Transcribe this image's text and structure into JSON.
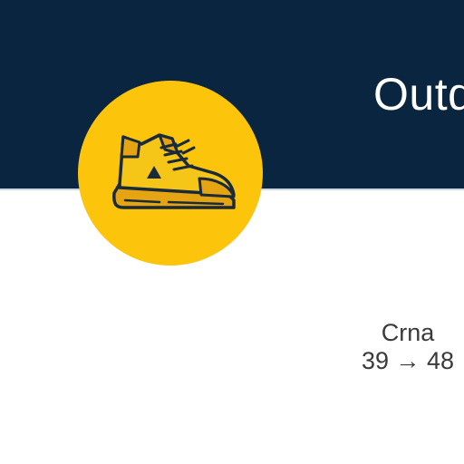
{
  "product": {
    "title": "Outdo",
    "icon": "hiking-boot-icon",
    "color_name": "Crna",
    "size_range": "39 → 48"
  },
  "colors": {
    "header_bg": "#0a2540",
    "icon_circle_bg": "#fcc40b",
    "boot_dark": "#1a2a3a",
    "boot_yellow": "#f5c518",
    "boot_amber": "#e5a412"
  }
}
